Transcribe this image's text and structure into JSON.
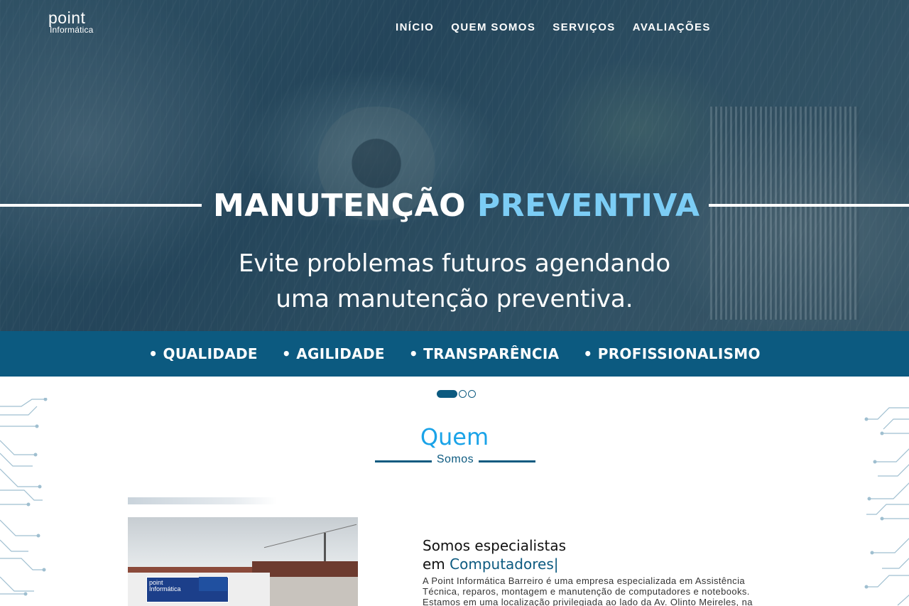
{
  "logo": {
    "line1": "point",
    "line2": "Informática"
  },
  "nav": {
    "items": [
      "INÍCIO",
      "QUEM SOMOS",
      "SERVIÇOS",
      "AVALIAÇÕES"
    ]
  },
  "hero": {
    "title_main": "MANUTENÇÃO",
    "title_accent": "PREVENTIVA",
    "subtitle_line1": "Evite problemas futuros agendando",
    "subtitle_line2": "uma manutenção preventiva."
  },
  "values": [
    "• QUALIDADE",
    "• AGILIDADE",
    "• TRANSPARÊNCIA",
    "• PROFISSIONALISMO"
  ],
  "carousel": {
    "slides": 3,
    "active_index": 0
  },
  "about": {
    "title": "Quem",
    "subtitle": "Somos",
    "photo_sign_line1": "point",
    "photo_sign_line2": "Informática",
    "heading_line1": "Somos especialistas",
    "heading_prefix": "em ",
    "heading_highlight": "Computadores|",
    "text": "A Point Informática Barreiro é uma empresa especializada em Assistência Técnica, reparos, montagem e manutenção de computadores e notebooks. Estamos em uma localização privilegiada ao lado da Av. Olinto Meireles, na"
  },
  "colors": {
    "brand_dark": "#0c5a80",
    "accent_light": "#7ccdf5",
    "section_title": "#1aa3e8"
  }
}
